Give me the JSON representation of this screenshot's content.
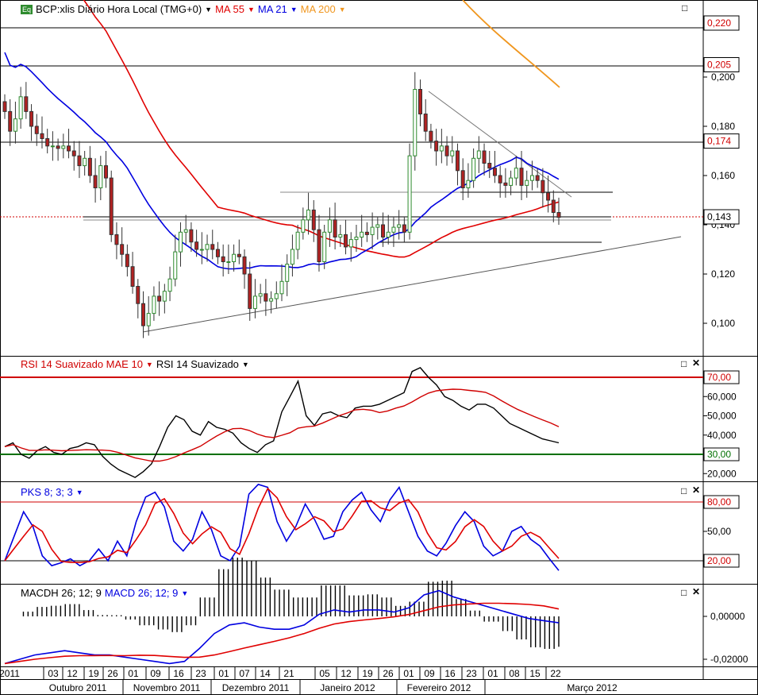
{
  "header": {
    "symbol_badge": "Eq",
    "symbol": "BCP:xlis Diário Hora Local (TMG+0)",
    "ma1": "MA 55",
    "ma2": "MA 21",
    "ma3": "MA 200"
  },
  "rsi_header": {
    "label1": "RSI 14 Suavizado MAE 10",
    "label2": "RSI 14 Suavizado"
  },
  "pks_header": {
    "label": "PKS 8; 3; 3"
  },
  "macd_header": {
    "label1": "MACDH 26; 12; 9",
    "label2": "MACD 26; 12; 9"
  },
  "price_ticks": [
    "0,200",
    "0,180",
    "0,160",
    "0,140",
    "0,120",
    "0,100"
  ],
  "price_boxes": [
    "0,220",
    "0,205",
    "0,174",
    "0,143"
  ],
  "rsi_ticks": [
    "70,00",
    "60,000",
    "50,000",
    "40,000",
    "30,00",
    "20,000"
  ],
  "pks_ticks": [
    "80,00",
    "50,00",
    "20,00"
  ],
  "macd_ticks": [
    "0,00000",
    "-0,02000"
  ],
  "date_ticks": [
    "2011",
    "03",
    "12",
    "19",
    "26",
    "01",
    "09",
    "16",
    "23",
    "01",
    "07",
    "14",
    "21",
    "05",
    "12",
    "19",
    "26",
    "01",
    "09",
    "16",
    "23",
    "01",
    "08",
    "15",
    "22"
  ],
  "month_labels": [
    "Outubro 2011",
    "Novembro 2011",
    "Dezembro 2011",
    "Janeiro 2012",
    "Fevereiro 2012",
    "Março 2012"
  ],
  "colors": {
    "ma55": "#e00000",
    "ma21": "#0000e0",
    "ma200": "#f0961e",
    "bull": "#2e8b2e",
    "bear": "#b22222",
    "rsi_hi": "#d00000",
    "rsi_lo": "#007000"
  },
  "chart_data": {
    "type": "candlestick",
    "price_axis": {
      "min": 0.09,
      "max": 0.225,
      "ticks": [
        0.2,
        0.18,
        0.16,
        0.14,
        0.12,
        0.1
      ]
    },
    "horizontal_levels": [
      0.22,
      0.205,
      0.174,
      0.143
    ],
    "last_price": 0.143,
    "close": [
      0.186,
      0.178,
      0.183,
      0.192,
      0.186,
      0.18,
      0.177,
      0.175,
      0.172,
      0.172,
      0.171,
      0.172,
      0.17,
      0.168,
      0.164,
      0.167,
      0.16,
      0.155,
      0.164,
      0.159,
      0.136,
      0.132,
      0.128,
      0.123,
      0.115,
      0.108,
      0.099,
      0.104,
      0.111,
      0.109,
      0.113,
      0.118,
      0.129,
      0.137,
      0.138,
      0.133,
      0.13,
      0.13,
      0.132,
      0.13,
      0.127,
      0.125,
      0.125,
      0.128,
      0.127,
      0.12,
      0.106,
      0.111,
      0.112,
      0.109,
      0.11,
      0.112,
      0.117,
      0.124,
      0.13,
      0.137,
      0.142,
      0.146,
      0.138,
      0.125,
      0.137,
      0.142,
      0.135,
      0.136,
      0.131,
      0.134,
      0.135,
      0.137,
      0.136,
      0.139,
      0.14,
      0.135,
      0.137,
      0.139,
      0.14,
      0.137,
      0.168,
      0.195,
      0.185,
      0.178,
      0.174,
      0.17,
      0.172,
      0.168,
      0.17,
      0.162,
      0.155,
      0.158,
      0.167,
      0.17,
      0.165,
      0.163,
      0.16,
      0.157,
      0.156,
      0.159,
      0.163,
      0.156,
      0.158,
      0.16,
      0.158,
      0.153,
      0.15,
      0.145,
      0.143
    ],
    "rsi": {
      "axis": [
        15,
        80
      ],
      "level_high": 70,
      "level_low": 30
    },
    "pks": {
      "axis": [
        0,
        100
      ],
      "level_high": 80,
      "level_low": 20
    },
    "macd": {
      "zero": 0.0,
      "ticks": [
        0.0,
        -0.02
      ]
    }
  }
}
